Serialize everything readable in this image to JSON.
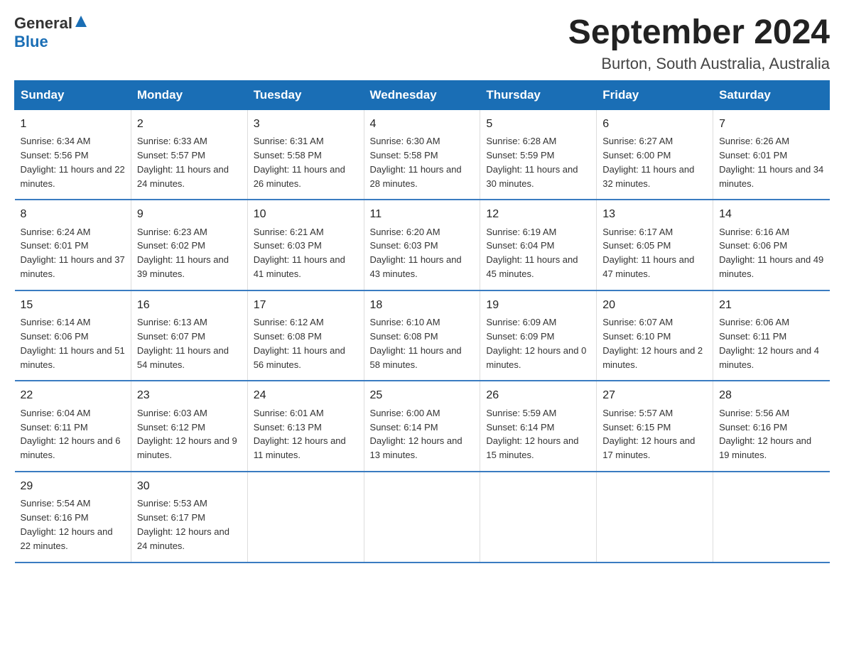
{
  "header": {
    "logo_general": "General",
    "logo_blue": "Blue",
    "month_title": "September 2024",
    "location": "Burton, South Australia, Australia"
  },
  "weekdays": [
    "Sunday",
    "Monday",
    "Tuesday",
    "Wednesday",
    "Thursday",
    "Friday",
    "Saturday"
  ],
  "weeks": [
    [
      {
        "day": "1",
        "sunrise": "6:34 AM",
        "sunset": "5:56 PM",
        "daylight": "11 hours and 22 minutes."
      },
      {
        "day": "2",
        "sunrise": "6:33 AM",
        "sunset": "5:57 PM",
        "daylight": "11 hours and 24 minutes."
      },
      {
        "day": "3",
        "sunrise": "6:31 AM",
        "sunset": "5:58 PM",
        "daylight": "11 hours and 26 minutes."
      },
      {
        "day": "4",
        "sunrise": "6:30 AM",
        "sunset": "5:58 PM",
        "daylight": "11 hours and 28 minutes."
      },
      {
        "day": "5",
        "sunrise": "6:28 AM",
        "sunset": "5:59 PM",
        "daylight": "11 hours and 30 minutes."
      },
      {
        "day": "6",
        "sunrise": "6:27 AM",
        "sunset": "6:00 PM",
        "daylight": "11 hours and 32 minutes."
      },
      {
        "day": "7",
        "sunrise": "6:26 AM",
        "sunset": "6:01 PM",
        "daylight": "11 hours and 34 minutes."
      }
    ],
    [
      {
        "day": "8",
        "sunrise": "6:24 AM",
        "sunset": "6:01 PM",
        "daylight": "11 hours and 37 minutes."
      },
      {
        "day": "9",
        "sunrise": "6:23 AM",
        "sunset": "6:02 PM",
        "daylight": "11 hours and 39 minutes."
      },
      {
        "day": "10",
        "sunrise": "6:21 AM",
        "sunset": "6:03 PM",
        "daylight": "11 hours and 41 minutes."
      },
      {
        "day": "11",
        "sunrise": "6:20 AM",
        "sunset": "6:03 PM",
        "daylight": "11 hours and 43 minutes."
      },
      {
        "day": "12",
        "sunrise": "6:19 AM",
        "sunset": "6:04 PM",
        "daylight": "11 hours and 45 minutes."
      },
      {
        "day": "13",
        "sunrise": "6:17 AM",
        "sunset": "6:05 PM",
        "daylight": "11 hours and 47 minutes."
      },
      {
        "day": "14",
        "sunrise": "6:16 AM",
        "sunset": "6:06 PM",
        "daylight": "11 hours and 49 minutes."
      }
    ],
    [
      {
        "day": "15",
        "sunrise": "6:14 AM",
        "sunset": "6:06 PM",
        "daylight": "11 hours and 51 minutes."
      },
      {
        "day": "16",
        "sunrise": "6:13 AM",
        "sunset": "6:07 PM",
        "daylight": "11 hours and 54 minutes."
      },
      {
        "day": "17",
        "sunrise": "6:12 AM",
        "sunset": "6:08 PM",
        "daylight": "11 hours and 56 minutes."
      },
      {
        "day": "18",
        "sunrise": "6:10 AM",
        "sunset": "6:08 PM",
        "daylight": "11 hours and 58 minutes."
      },
      {
        "day": "19",
        "sunrise": "6:09 AM",
        "sunset": "6:09 PM",
        "daylight": "12 hours and 0 minutes."
      },
      {
        "day": "20",
        "sunrise": "6:07 AM",
        "sunset": "6:10 PM",
        "daylight": "12 hours and 2 minutes."
      },
      {
        "day": "21",
        "sunrise": "6:06 AM",
        "sunset": "6:11 PM",
        "daylight": "12 hours and 4 minutes."
      }
    ],
    [
      {
        "day": "22",
        "sunrise": "6:04 AM",
        "sunset": "6:11 PM",
        "daylight": "12 hours and 6 minutes."
      },
      {
        "day": "23",
        "sunrise": "6:03 AM",
        "sunset": "6:12 PM",
        "daylight": "12 hours and 9 minutes."
      },
      {
        "day": "24",
        "sunrise": "6:01 AM",
        "sunset": "6:13 PM",
        "daylight": "12 hours and 11 minutes."
      },
      {
        "day": "25",
        "sunrise": "6:00 AM",
        "sunset": "6:14 PM",
        "daylight": "12 hours and 13 minutes."
      },
      {
        "day": "26",
        "sunrise": "5:59 AM",
        "sunset": "6:14 PM",
        "daylight": "12 hours and 15 minutes."
      },
      {
        "day": "27",
        "sunrise": "5:57 AM",
        "sunset": "6:15 PM",
        "daylight": "12 hours and 17 minutes."
      },
      {
        "day": "28",
        "sunrise": "5:56 AM",
        "sunset": "6:16 PM",
        "daylight": "12 hours and 19 minutes."
      }
    ],
    [
      {
        "day": "29",
        "sunrise": "5:54 AM",
        "sunset": "6:16 PM",
        "daylight": "12 hours and 22 minutes."
      },
      {
        "day": "30",
        "sunrise": "5:53 AM",
        "sunset": "6:17 PM",
        "daylight": "12 hours and 24 minutes."
      },
      {
        "day": "",
        "sunrise": "",
        "sunset": "",
        "daylight": ""
      },
      {
        "day": "",
        "sunrise": "",
        "sunset": "",
        "daylight": ""
      },
      {
        "day": "",
        "sunrise": "",
        "sunset": "",
        "daylight": ""
      },
      {
        "day": "",
        "sunrise": "",
        "sunset": "",
        "daylight": ""
      },
      {
        "day": "",
        "sunrise": "",
        "sunset": "",
        "daylight": ""
      }
    ]
  ],
  "labels": {
    "sunrise": "Sunrise:",
    "sunset": "Sunset:",
    "daylight": "Daylight:"
  }
}
